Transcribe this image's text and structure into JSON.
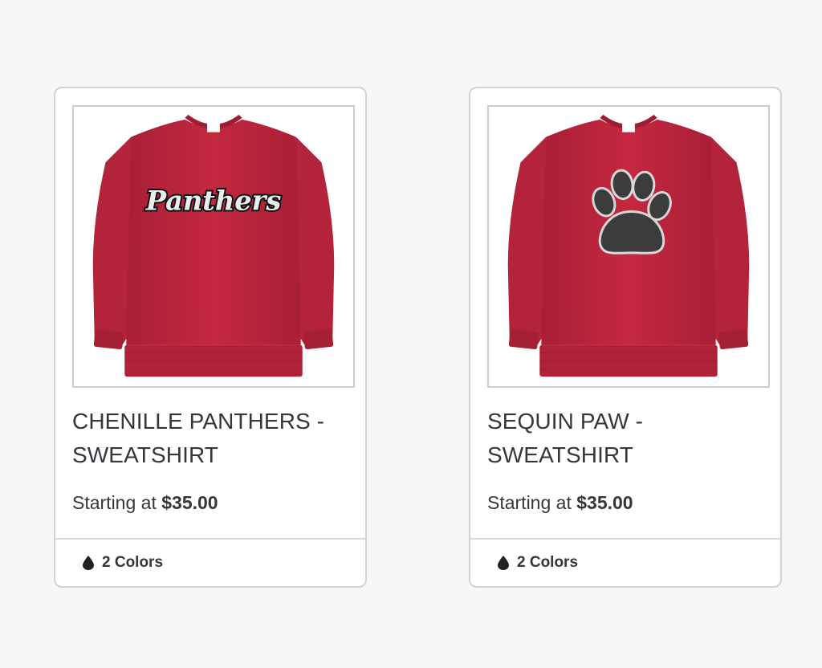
{
  "products": [
    {
      "title": "CHENILLE PANTHERS - SWEATSHIRT",
      "price_prefix": "Starting at",
      "price": "$35.00",
      "colors_label": "2 Colors",
      "image": {
        "graphic": "Panthers",
        "garment_color": "#c0263f"
      }
    },
    {
      "title": "SEQUIN PAW - SWEATSHIRT",
      "price_prefix": "Starting at",
      "price": "$35.00",
      "colors_label": "2 Colors",
      "image": {
        "graphic": "paw-print",
        "garment_color": "#c0263f"
      }
    }
  ],
  "icons": {
    "colors": "droplet-icon"
  },
  "colors": {
    "page_background": "#f7f7f8",
    "card_border": "#ccd3db",
    "text": "#33363b"
  }
}
